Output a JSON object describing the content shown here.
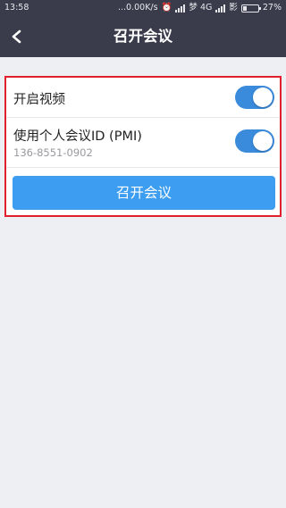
{
  "status_bar": {
    "time": "13:58",
    "net_speed": "...0.00K/s",
    "carrier": "梦 4G",
    "battery": "27%",
    "battery_level": 0.27
  },
  "header": {
    "title": "召开会议"
  },
  "settings": {
    "video": {
      "label": "开启视频",
      "enabled": true
    },
    "pmi": {
      "label": "使用个人会议ID (PMI)",
      "value": "136-8551-0902",
      "enabled": true
    }
  },
  "actions": {
    "start_label": "召开会议"
  },
  "colors": {
    "header_bg": "#3a3c4c",
    "toggle_on": "#3a8bdc",
    "button_bg": "#3d9df0",
    "highlight_border": "#e0202b"
  }
}
